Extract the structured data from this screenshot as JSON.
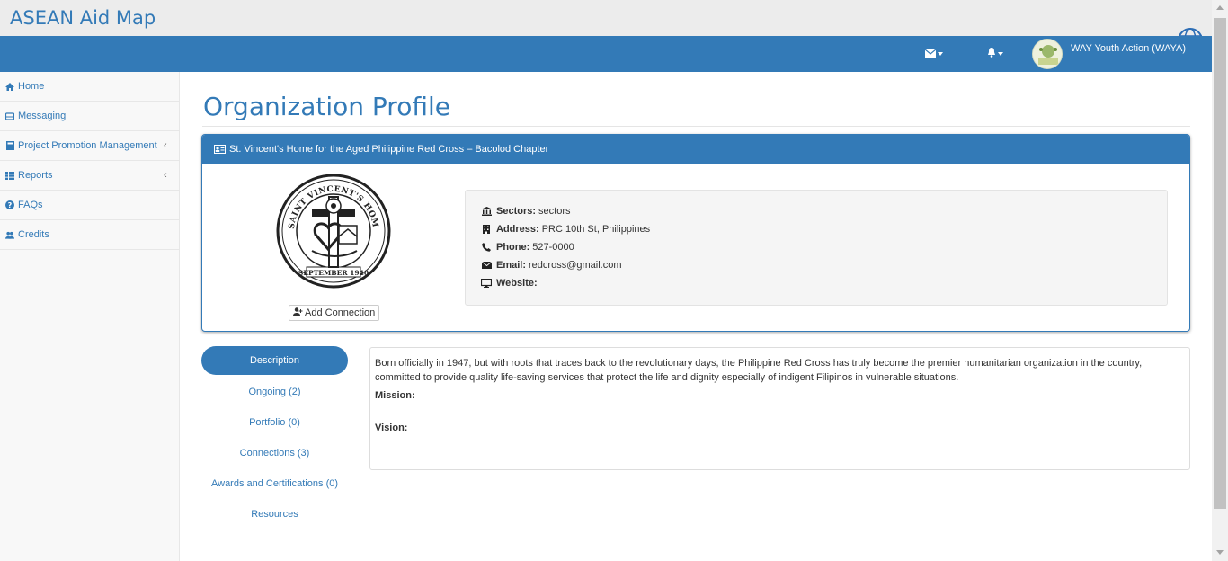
{
  "app": {
    "title": "ASEAN Aid Map"
  },
  "header": {
    "user_name": "WAY Youth Action (WAYA)",
    "icons": [
      "envelope-icon",
      "bell-icon",
      "globe-icon"
    ]
  },
  "sidebar": {
    "items": [
      {
        "label": "Home",
        "icon": "home-icon"
      },
      {
        "label": "Messaging",
        "icon": "inbox-icon"
      },
      {
        "label": "Project Promotion Management",
        "icon": "book-icon",
        "chevron": "‹"
      },
      {
        "label": "Reports",
        "icon": "list-icon",
        "chevron": "‹"
      },
      {
        "label": "FAQs",
        "icon": "question-icon"
      },
      {
        "label": "Credits",
        "icon": "users-icon"
      }
    ]
  },
  "page": {
    "title": "Organization Profile"
  },
  "organization": {
    "name": "St. Vincent's Home for the Aged Philippine Red Cross – Bacolod Chapter",
    "add_connection_label": "Add Connection",
    "seal_top": "SAINT VINCENT'S HOME, INCORPORATED",
    "seal_bottom": "SEPTEMBER 1940",
    "fields": [
      {
        "label": "Sectors:",
        "value": "sectors",
        "icon": "institution-icon"
      },
      {
        "label": "Address:",
        "value": "PRC 10th St, Philippines",
        "icon": "building-icon"
      },
      {
        "label": "Phone:",
        "value": "527-0000",
        "icon": "phone-icon"
      },
      {
        "label": "Email:",
        "value": "redcross@gmail.com",
        "icon": "envelope-icon"
      },
      {
        "label": "Website:",
        "value": "",
        "icon": "desktop-icon"
      }
    ]
  },
  "tabs": [
    {
      "label": "Description",
      "active": true
    },
    {
      "label": "Ongoing (2)"
    },
    {
      "label": "Portfolio (0)"
    },
    {
      "label": "Connections (3)"
    },
    {
      "label": "Awards and Certifications (0)"
    },
    {
      "label": "Resources"
    }
  ],
  "description": {
    "text": "Born officially in 1947, but with roots that traces back to the revolutionary days, the Philippine Red Cross has truly become the premier humanitarian organization in the country, committed to provide quality life-saving services that protect the life and dignity especially of indigent Filipinos in vulnerable situations.",
    "mission_label": "Mission:",
    "vision_label": "Vision:"
  },
  "colors": {
    "primary": "#337ab7",
    "brandbar": "#ececec",
    "sidebar": "#f8f8f8"
  }
}
